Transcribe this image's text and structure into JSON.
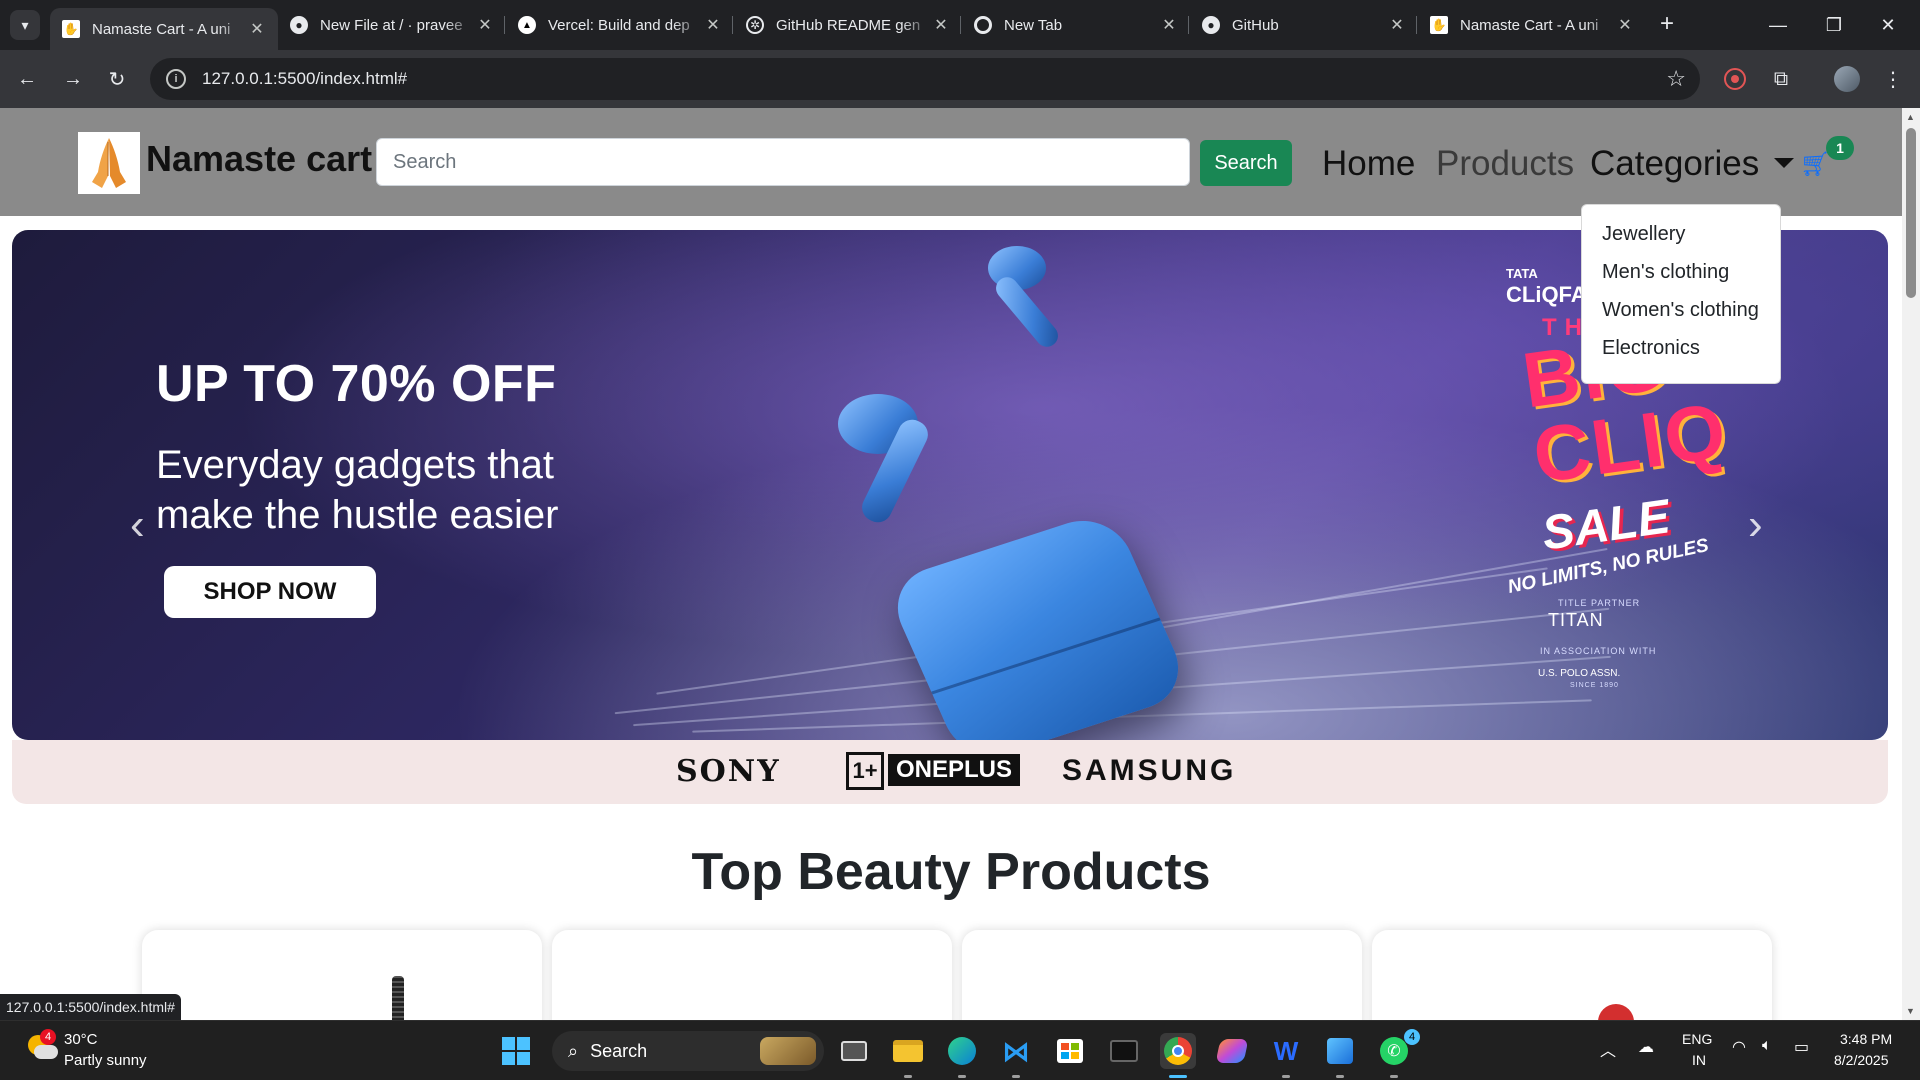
{
  "browser": {
    "tabs": [
      {
        "title": "Namaste Cart - A uni",
        "favicon": "praying-hands-icon",
        "active": true
      },
      {
        "title": "New File at / · pravee",
        "favicon": "github-icon",
        "active": false
      },
      {
        "title": "Vercel: Build and dep",
        "favicon": "vercel-icon",
        "active": false
      },
      {
        "title": "GitHub README gen",
        "favicon": "openai-icon",
        "active": false
      },
      {
        "title": "New Tab",
        "favicon": "chrome-icon",
        "active": false
      },
      {
        "title": "GitHub",
        "favicon": "github-icon",
        "active": false
      },
      {
        "title": "Namaste Cart - A uni",
        "favicon": "praying-hands-icon",
        "active": false
      }
    ],
    "url": "127.0.0.1:5500/index.html#",
    "status_url": "127.0.0.1:5500/index.html#"
  },
  "site": {
    "brand": "Namaste cart",
    "search_placeholder": "Search",
    "search_button": "Search",
    "nav": {
      "home": "Home",
      "products": "Products",
      "categories": "Categories"
    },
    "cart_count": "1",
    "categories": [
      "Jewellery",
      "Men's clothing",
      "Women's clothing",
      "Electronics"
    ],
    "hero": {
      "headline": "UP TO 70% OFF",
      "subline": "Everyday gadgets that make the hustle easier",
      "cta": "SHOP NOW",
      "promo": {
        "tata": "TATA",
        "cliq": "CLiQFA",
        "the": "THE",
        "big_cliq": "BIG CLIQ",
        "sale": "SALE",
        "tagline": "NO LIMITS, NO RULES",
        "partner_label": "TITLE PARTNER",
        "partner": "TITAN",
        "assoc_label": "IN ASSOCIATION WITH",
        "assoc": "U.S. POLO ASSN.",
        "since": "SINCE 1890"
      }
    },
    "brands": {
      "sony": "SONY",
      "oneplus_logo": "1+",
      "oneplus": "ONEPLUS",
      "samsung": "SAMSUNG"
    },
    "section_title": "Top Beauty Products"
  },
  "taskbar": {
    "weather_alerts": "4",
    "temperature": "30°C",
    "weather": "Partly sunny",
    "search": "Search",
    "whatsapp_badge": "4",
    "lang": "ENG",
    "region": "IN",
    "time": "3:48 PM",
    "date": "8/2/2025"
  },
  "colors": {
    "navbar": "#8a8a8a",
    "success": "#198754",
    "cart": "#0d6efd",
    "brand_strip": "#f3e6e6",
    "chrome_dark": "#202124",
    "chrome_toolbar": "#35363a"
  }
}
